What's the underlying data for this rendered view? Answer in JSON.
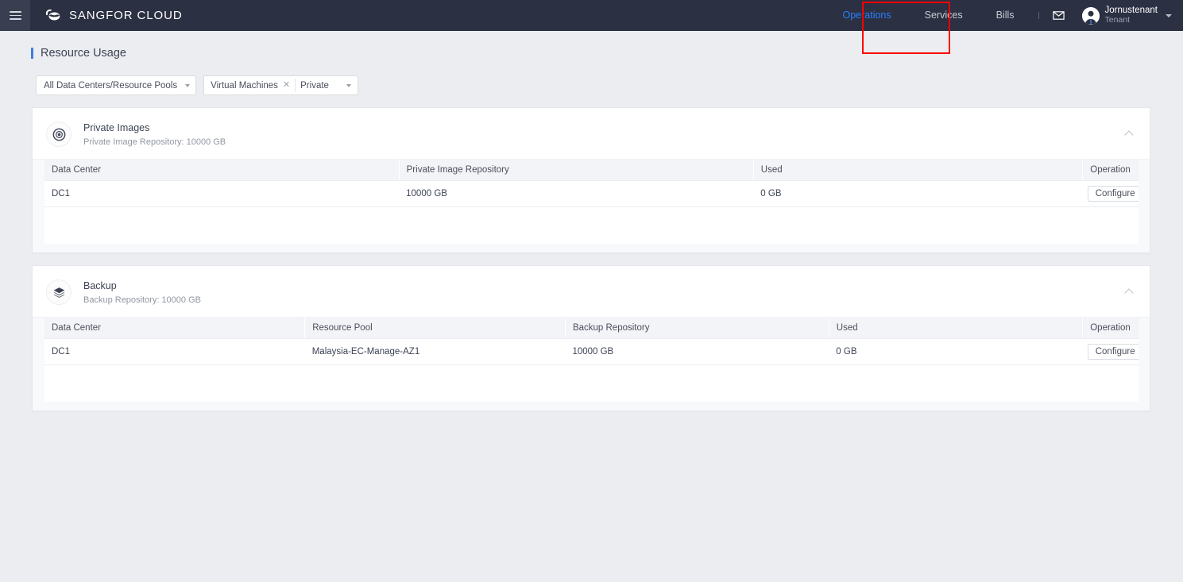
{
  "header": {
    "menu_icon": "hamburger-icon",
    "brand": "SANGFOR CLOUD",
    "brand_logo_icon": "cloud-logo-icon",
    "nav": [
      {
        "label": "Operations",
        "active": true
      },
      {
        "label": "Services",
        "active": false
      },
      {
        "label": "Bills",
        "active": false
      }
    ],
    "mail_icon": "mail-envelope-icon",
    "user": {
      "name": "Jornustenant",
      "role": "Tenant",
      "avatar_icon": "user-avatar-icon",
      "caret_icon": "chevron-down-icon"
    },
    "highlight_color": "#ff0000"
  },
  "page": {
    "title": "Resource Usage",
    "accent_color": "#3d7fe0"
  },
  "filters": {
    "datacenter_select": {
      "value": "All Data Centers/Resource Pools",
      "caret_icon": "chevron-down-icon"
    },
    "resource_select": {
      "tag": "Virtual Machines",
      "tag_close_icon": "close-icon",
      "value": "Private",
      "caret_icon": "chevron-down-icon"
    }
  },
  "cards": [
    {
      "icon": "disc-image-icon",
      "title": "Private Images",
      "subtitle": "Private Image Repository: 10000 GB",
      "collapse_icon": "chevron-up-icon",
      "columns": [
        "Data Center",
        "Private Image Repository",
        "Used",
        "Operation"
      ],
      "rows": [
        {
          "data_center": "DC1",
          "repository": "10000 GB",
          "used": "0 GB",
          "operation": "Configure"
        }
      ]
    },
    {
      "icon": "layers-backup-icon",
      "title": "Backup",
      "subtitle": "Backup Repository: 10000 GB",
      "collapse_icon": "chevron-up-icon",
      "columns": [
        "Data Center",
        "Resource Pool",
        "Backup Repository",
        "Used",
        "Operation"
      ],
      "rows": [
        {
          "data_center": "DC1",
          "resource_pool": "Malaysia-EC-Manage-AZ1",
          "repository": "10000 GB",
          "used": "0 GB",
          "operation": "Configure"
        }
      ]
    }
  ]
}
